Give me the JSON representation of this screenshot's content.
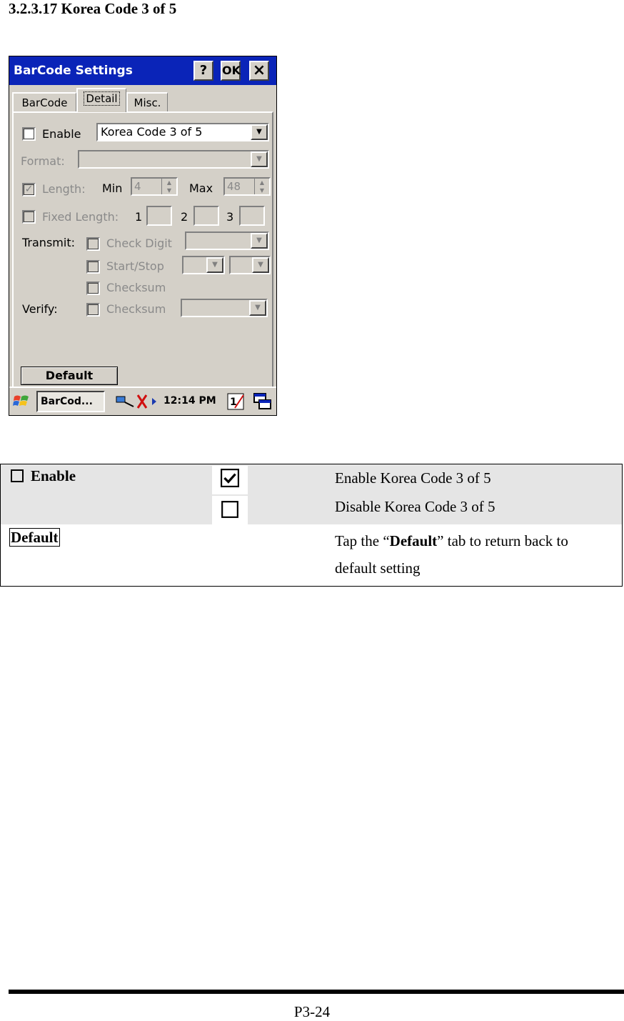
{
  "heading": "3.2.3.17 Korea Code 3 of 5",
  "device": {
    "window_title": "BarCode Settings",
    "title_buttons": {
      "help": "?",
      "ok": "OK",
      "close": "×"
    },
    "tabs": [
      "BarCode",
      "Detail",
      "Misc."
    ],
    "active_tab": "Detail",
    "enable_label": "Enable",
    "symbology_value": "Korea Code 3 of 5",
    "format_label": "Format:",
    "length_label": "Length:",
    "min_label": "Min",
    "min_value": "4",
    "max_label": "Max",
    "max_value": "48",
    "fixed_length_label": "Fixed Length:",
    "fixed_1": "1",
    "fixed_2": "2",
    "fixed_3": "3",
    "transmit_label": "Transmit:",
    "check_digit_label": "Check Digit",
    "start_stop_label": "Start/Stop",
    "checksum_label": "Checksum",
    "verify_label": "Verify:",
    "verify_checksum_label": "Checksum",
    "default_button": "Default",
    "taskbar_app": "BarCod...",
    "clock": "12:14 PM",
    "tray_badge": "1"
  },
  "table": {
    "enable_label": "Enable",
    "enable_on_desc": "Enable Korea Code 3 of 5",
    "enable_off_desc": "Disable Korea Code 3 of 5",
    "default_label": "Default",
    "default_desc_pre": "Tap the “",
    "default_desc_bold": "Default",
    "default_desc_post": "” tab to return back to default setting"
  },
  "footer": {
    "page_number": "P3-24"
  },
  "colors": {
    "titlebar": "#0a24b8",
    "dialog_face": "#d4d0c8",
    "table_shade": "#e5e5e5"
  }
}
